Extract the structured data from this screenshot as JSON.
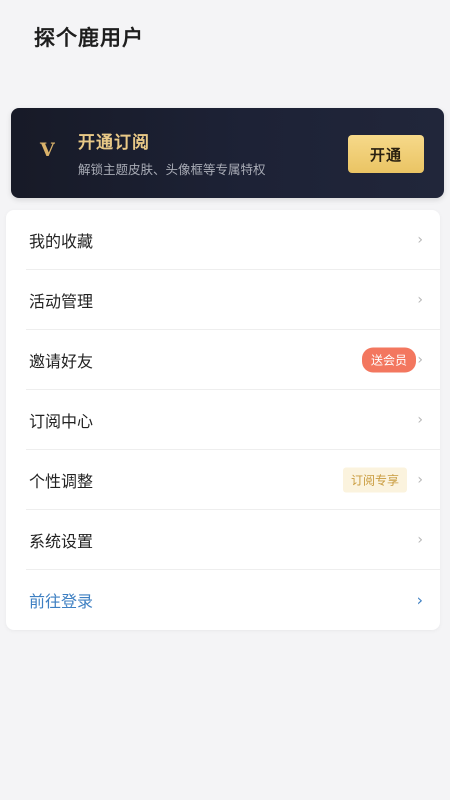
{
  "header": {
    "username": "探个鹿用户"
  },
  "vip": {
    "badge": "V",
    "title": "开通订阅",
    "subtitle": "解锁主题皮肤、头像框等专属特权",
    "button_label": "开通"
  },
  "menu": {
    "items": [
      {
        "label": "我的收藏"
      },
      {
        "label": "活动管理"
      },
      {
        "label": "邀请好友",
        "badge": "送会员"
      },
      {
        "label": "订阅中心"
      },
      {
        "label": "个性调整",
        "badge": "订阅专享"
      },
      {
        "label": "系统设置"
      },
      {
        "label": "前往登录"
      }
    ],
    "chevron": "›"
  },
  "colors": {
    "accent_gold": "#e9c987",
    "link_blue": "#3d7fc2",
    "gift_badge": "#f3775f"
  }
}
